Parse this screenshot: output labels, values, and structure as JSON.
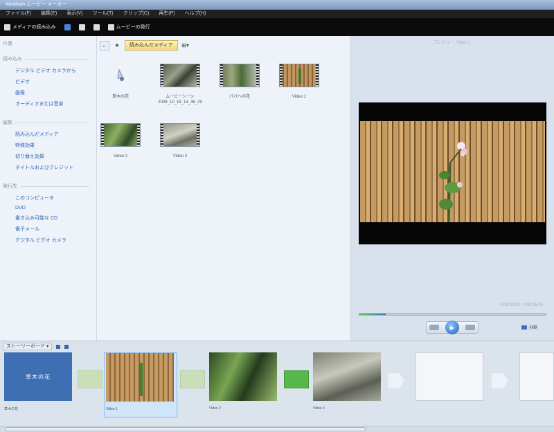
{
  "window": {
    "title": "Windows ムービー メーカー"
  },
  "menu": [
    "ファイル(F)",
    "編集(E)",
    "表示(V)",
    "ツール(T)",
    "クリップ(C)",
    "再生(P)",
    "ヘルプ(H)"
  ],
  "toolbar": {
    "import_label": "メディアの読み込み",
    "publish_label": "ムービーの発行"
  },
  "tasks": {
    "panel_title": "作業",
    "sections": [
      {
        "heading": "読み込み",
        "items": [
          "デジタル ビデオ カメラから",
          "ビデオ",
          "画像",
          "オーディオまたは音楽"
        ]
      },
      {
        "heading": "編集",
        "items": [
          "読み込んだメディア",
          "特殊効果",
          "切り替え効果",
          "タイトルおよびクレジット"
        ]
      },
      {
        "heading": "発行先",
        "items": [
          "このコンピュータ",
          "DVD",
          "書き込み可能な CD",
          "電子メール",
          "デジタル ビデオ カメラ"
        ]
      }
    ]
  },
  "browser": {
    "folder": "読み込んだメディア",
    "clips": [
      {
        "label": "草木の花"
      },
      {
        "label": "ムービーシーン 2009_10_15_14_46_29"
      },
      {
        "label": "パパへの花"
      },
      {
        "label": "Video 1"
      },
      {
        "label": "Video 2"
      },
      {
        "label": "Video 3"
      }
    ]
  },
  "preview": {
    "header": "プレビュー: Video 1",
    "time": "0:00:00.00 / 0:00:05.00",
    "progress": 0.14,
    "split_label": "分割"
  },
  "storyboard": {
    "mode": "ストーリーボード",
    "items": [
      {
        "type": "title",
        "text": "草木の花",
        "caption": "草木の花"
      },
      {
        "type": "clip",
        "caption": "Video 1"
      },
      {
        "type": "clip",
        "caption": "Video 2"
      },
      {
        "type": "clip",
        "caption": "Video 3"
      },
      {
        "type": "empty",
        "caption": ""
      },
      {
        "type": "empty",
        "caption": ""
      }
    ]
  }
}
